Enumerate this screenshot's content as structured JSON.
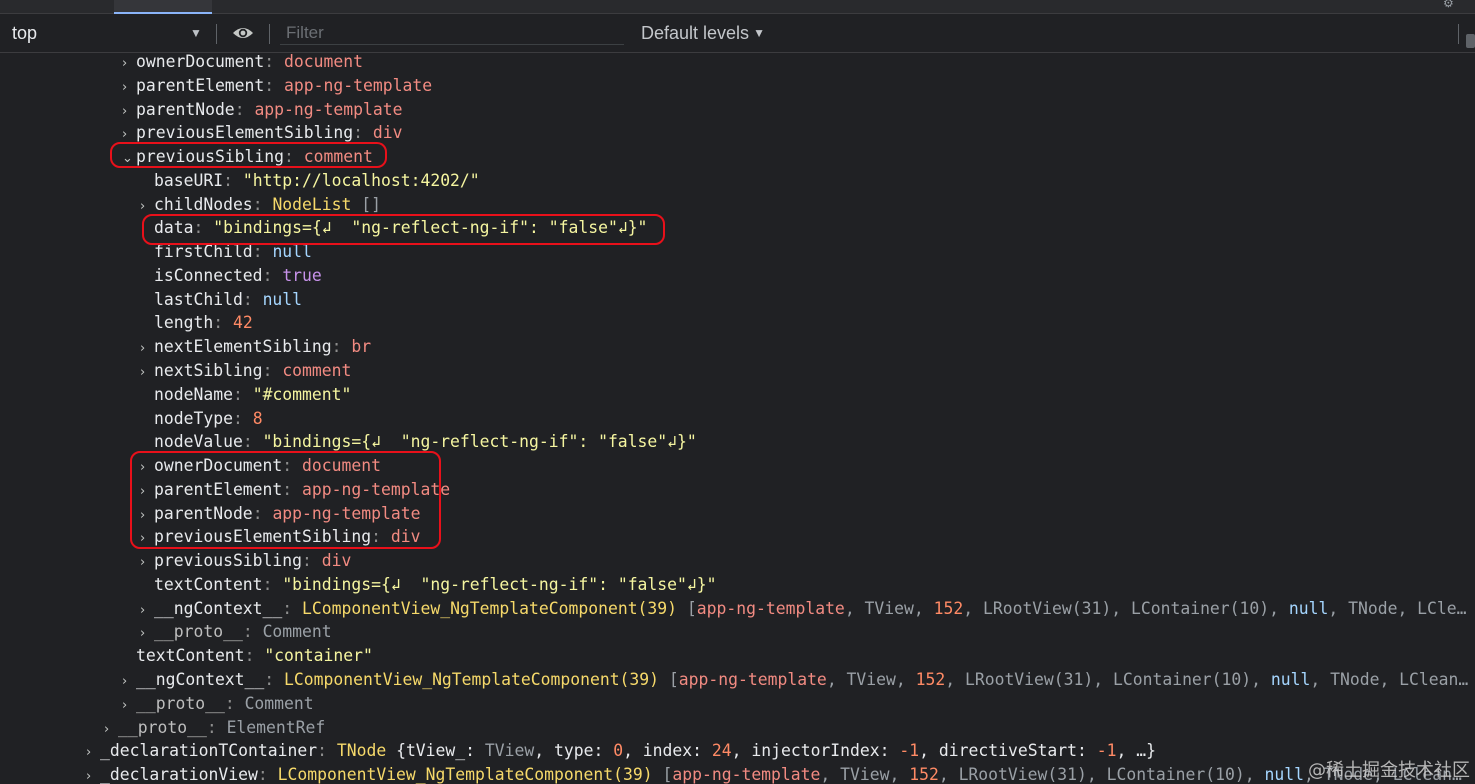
{
  "toolbar": {
    "context": "top",
    "filter_placeholder": "Filter",
    "levels": "Default levels"
  },
  "lines": [
    {
      "indent": 122,
      "arrow": "›",
      "key": "ownerDocument",
      "parts": [
        {
          "t": "document",
          "c": "v-obj"
        }
      ]
    },
    {
      "indent": 122,
      "arrow": "›",
      "key": "parentElement",
      "parts": [
        {
          "t": "app-ng-template",
          "c": "v-obj"
        }
      ]
    },
    {
      "indent": 122,
      "arrow": "›",
      "key": "parentNode",
      "parts": [
        {
          "t": "app-ng-template",
          "c": "v-obj"
        }
      ]
    },
    {
      "indent": 122,
      "arrow": "›",
      "key": "previousElementSibling",
      "parts": [
        {
          "t": "div",
          "c": "v-obj"
        }
      ]
    },
    {
      "indent": 122,
      "arrow": "⌄",
      "key": "previousSibling",
      "parts": [
        {
          "t": "comment",
          "c": "v-obj"
        }
      ]
    },
    {
      "indent": 140,
      "arrow": "",
      "key": "baseURI",
      "parts": [
        {
          "t": "\"http://localhost:4202/\"",
          "c": "v-str"
        }
      ]
    },
    {
      "indent": 140,
      "arrow": "›",
      "key": "childNodes",
      "parts": [
        {
          "t": "NodeList",
          "c": "v-class"
        },
        {
          "t": " []",
          "c": "v-gray"
        }
      ]
    },
    {
      "indent": 140,
      "arrow": "",
      "key": "data",
      "parts": [
        {
          "t": "\"bindings={↲  \"ng-reflect-ng-if\": \"false\"↲}\"",
          "c": "v-str"
        }
      ]
    },
    {
      "indent": 140,
      "arrow": "",
      "key": "firstChild",
      "parts": [
        {
          "t": "null",
          "c": "v-null"
        }
      ]
    },
    {
      "indent": 140,
      "arrow": "",
      "key": "isConnected",
      "parts": [
        {
          "t": "true",
          "c": "v-bool"
        }
      ]
    },
    {
      "indent": 140,
      "arrow": "",
      "key": "lastChild",
      "parts": [
        {
          "t": "null",
          "c": "v-null"
        }
      ]
    },
    {
      "indent": 140,
      "arrow": "",
      "key": "length",
      "parts": [
        {
          "t": "42",
          "c": "v-num2"
        }
      ]
    },
    {
      "indent": 140,
      "arrow": "›",
      "key": "nextElementSibling",
      "parts": [
        {
          "t": "br",
          "c": "v-obj"
        }
      ]
    },
    {
      "indent": 140,
      "arrow": "›",
      "key": "nextSibling",
      "parts": [
        {
          "t": "comment",
          "c": "v-obj"
        }
      ]
    },
    {
      "indent": 140,
      "arrow": "",
      "key": "nodeName",
      "parts": [
        {
          "t": "\"#comment\"",
          "c": "v-str"
        }
      ]
    },
    {
      "indent": 140,
      "arrow": "",
      "key": "nodeType",
      "parts": [
        {
          "t": "8",
          "c": "v-num2"
        }
      ]
    },
    {
      "indent": 140,
      "arrow": "",
      "key": "nodeValue",
      "parts": [
        {
          "t": "\"bindings={↲  \"ng-reflect-ng-if\": \"false\"↲}\"",
          "c": "v-str"
        }
      ]
    },
    {
      "indent": 140,
      "arrow": "›",
      "key": "ownerDocument",
      "parts": [
        {
          "t": "document",
          "c": "v-obj"
        }
      ]
    },
    {
      "indent": 140,
      "arrow": "›",
      "key": "parentElement",
      "parts": [
        {
          "t": "app-ng-template",
          "c": "v-obj"
        }
      ]
    },
    {
      "indent": 140,
      "arrow": "›",
      "key": "parentNode",
      "parts": [
        {
          "t": "app-ng-template",
          "c": "v-obj"
        }
      ]
    },
    {
      "indent": 140,
      "arrow": "›",
      "key": "previousElementSibling",
      "parts": [
        {
          "t": "div",
          "c": "v-obj"
        }
      ]
    },
    {
      "indent": 140,
      "arrow": "›",
      "key": "previousSibling",
      "parts": [
        {
          "t": "div",
          "c": "v-obj"
        }
      ]
    },
    {
      "indent": 140,
      "arrow": "",
      "key": "textContent",
      "parts": [
        {
          "t": "\"bindings={↲  \"ng-reflect-ng-if\": \"false\"↲}\"",
          "c": "v-str"
        }
      ]
    },
    {
      "indent": 140,
      "arrow": "›",
      "key": "__ngContext__",
      "parts": [
        {
          "t": "LComponentView_NgTemplateComponent(39)",
          "c": "v-class"
        },
        {
          "t": " [",
          "c": "v-gray"
        },
        {
          "t": "app-ng-template",
          "c": "v-obj"
        },
        {
          "t": ", TView, ",
          "c": "v-gray"
        },
        {
          "t": "152",
          "c": "v-num2"
        },
        {
          "t": ", LRootView(31), LContainer(10), ",
          "c": "v-gray"
        },
        {
          "t": "null",
          "c": "v-null"
        },
        {
          "t": ", TNode, LCle…",
          "c": "v-gray"
        }
      ]
    },
    {
      "indent": 140,
      "arrow": "›",
      "key": "__proto__",
      "dim": true,
      "parts": [
        {
          "t": "Comment",
          "c": "v-gray"
        }
      ]
    },
    {
      "indent": 122,
      "arrow": "",
      "key": "textContent",
      "parts": [
        {
          "t": "\"container\"",
          "c": "v-str"
        }
      ]
    },
    {
      "indent": 122,
      "arrow": "›",
      "key": "__ngContext__",
      "parts": [
        {
          "t": "LComponentView_NgTemplateComponent(39)",
          "c": "v-class"
        },
        {
          "t": " [",
          "c": "v-gray"
        },
        {
          "t": "app-ng-template",
          "c": "v-obj"
        },
        {
          "t": ", TView, ",
          "c": "v-gray"
        },
        {
          "t": "152",
          "c": "v-num2"
        },
        {
          "t": ", LRootView(31), LContainer(10), ",
          "c": "v-gray"
        },
        {
          "t": "null",
          "c": "v-null"
        },
        {
          "t": ", TNode, LClean…",
          "c": "v-gray"
        }
      ]
    },
    {
      "indent": 122,
      "arrow": "›",
      "key": "__proto__",
      "dim": true,
      "parts": [
        {
          "t": "Comment",
          "c": "v-gray"
        }
      ]
    },
    {
      "indent": 104,
      "arrow": "›",
      "key": "__proto__",
      "dim": true,
      "parts": [
        {
          "t": "ElementRef",
          "c": "v-gray"
        }
      ]
    },
    {
      "indent": 86,
      "arrow": "›",
      "key": "_declarationTContainer",
      "parts": [
        {
          "t": "TNode",
          "c": "v-class"
        },
        {
          "t": " {tView_: ",
          "c": "k"
        },
        {
          "t": "TView",
          "c": "v-gray"
        },
        {
          "t": ", type: ",
          "c": "k"
        },
        {
          "t": "0",
          "c": "v-num2"
        },
        {
          "t": ", index: ",
          "c": "k"
        },
        {
          "t": "24",
          "c": "v-num2"
        },
        {
          "t": ", injectorIndex: ",
          "c": "k"
        },
        {
          "t": "-1",
          "c": "v-num2"
        },
        {
          "t": ", directiveStart: ",
          "c": "k"
        },
        {
          "t": "-1",
          "c": "v-num2"
        },
        {
          "t": ", …}",
          "c": "k"
        }
      ]
    },
    {
      "indent": 86,
      "arrow": "›",
      "key": "_declarationView",
      "parts": [
        {
          "t": "LComponentView_NgTemplateComponent(39)",
          "c": "v-class"
        },
        {
          "t": " [",
          "c": "v-gray"
        },
        {
          "t": "app-ng-template",
          "c": "v-obj"
        },
        {
          "t": ", TView, ",
          "c": "v-gray"
        },
        {
          "t": "152",
          "c": "v-num2"
        },
        {
          "t": ", LRootView(31), LContainer(10), ",
          "c": "v-gray"
        },
        {
          "t": "null",
          "c": "v-null"
        },
        {
          "t": ", TNode, LClean…",
          "c": "v-gray"
        }
      ]
    }
  ],
  "watermark": "@稀土掘金技术社区"
}
